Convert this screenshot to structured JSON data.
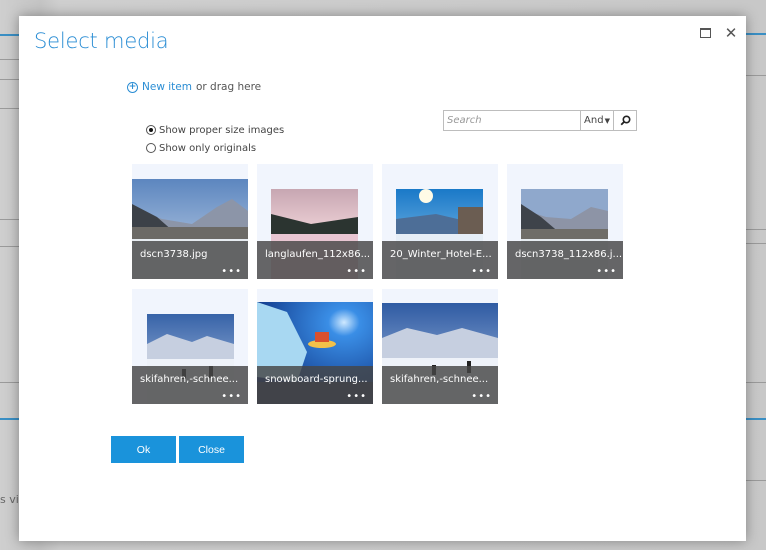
{
  "background": {
    "partial_text": "s vie"
  },
  "dialog": {
    "title": "Select media",
    "maximize_icon": "maximize-icon",
    "close_icon": "close-icon",
    "close_glyph": "✕"
  },
  "upload": {
    "icon": "plus-circle-icon",
    "link_label": "New item",
    "drag_text": "or drag here"
  },
  "search": {
    "placeholder": "Search",
    "value": "",
    "operator": "And",
    "operator_options_selected": "And",
    "search_icon": "search-icon"
  },
  "size_options": [
    {
      "label": "Show proper size images",
      "selected": true
    },
    {
      "label": "Show only originals",
      "selected": false
    }
  ],
  "media_items": [
    {
      "name": "dscn3738.jpg",
      "scene": "village",
      "menu": "..."
    },
    {
      "name": "langlaufen_112x86...",
      "scene": "sunset",
      "menu": "..."
    },
    {
      "name": "20_Winter_Hotel-E...",
      "scene": "sky",
      "menu": "..."
    },
    {
      "name": "dscn3738_112x86.j...",
      "scene": "village",
      "menu": "..."
    },
    {
      "name": "skifahren,-schnee...",
      "scene": "ski",
      "menu": "..."
    },
    {
      "name": "snowboard-sprung...",
      "scene": "snowboard",
      "menu": "..."
    },
    {
      "name": "skifahren,-schnee...",
      "scene": "ski",
      "menu": "..."
    }
  ],
  "buttons": {
    "ok": "Ok",
    "close": "Close"
  },
  "colors": {
    "accent": "#1a93db",
    "title": "#2a8dd4",
    "tile_bg": "#f1f5fd",
    "caption_bg": "#464646"
  }
}
